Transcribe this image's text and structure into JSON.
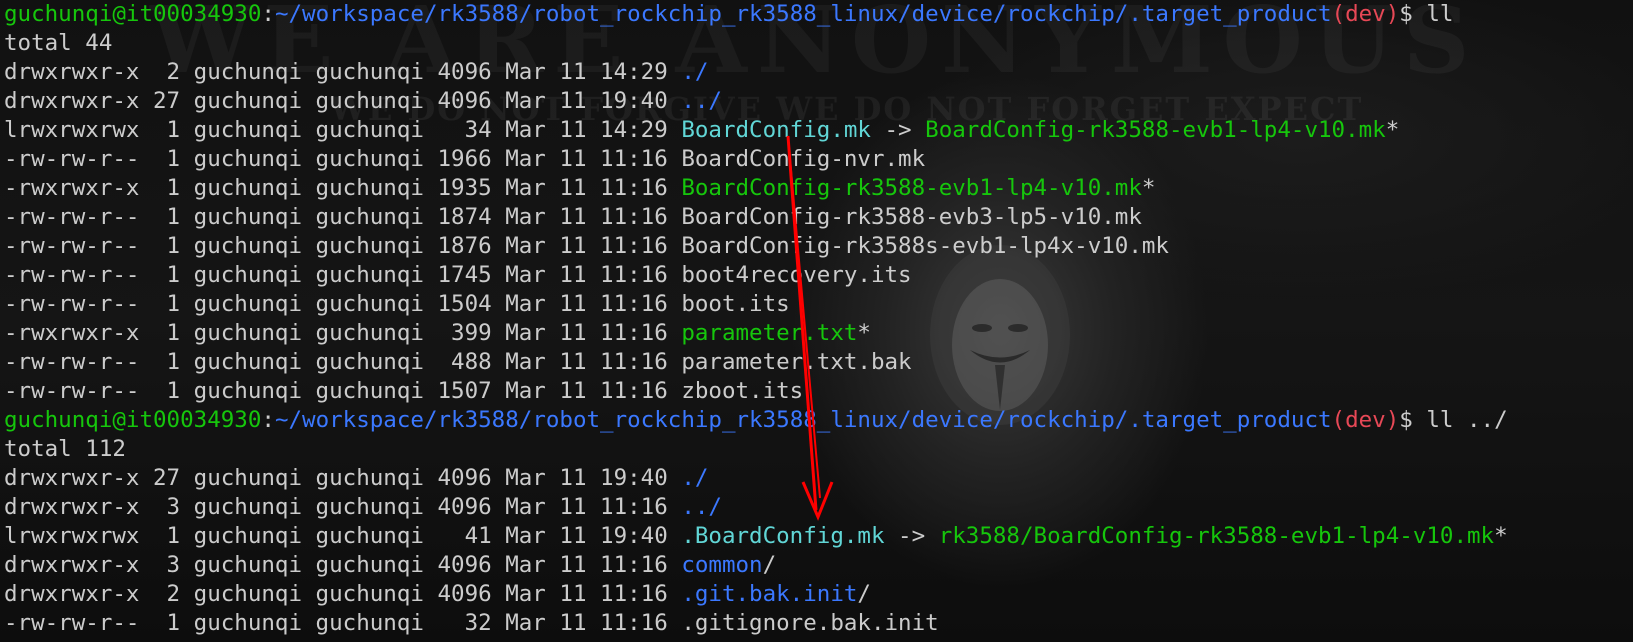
{
  "wallpaper": {
    "big_text": "WE ARE ANONYMOUS",
    "sub_text": "WE DO NOT FORGIVE WE DO NOT FORGET EXPECT"
  },
  "prompt1": {
    "user": "guchunqi@it00034930",
    "sep": ":",
    "path": "~/workspace/rk3588/robot_rockchip_rk3588_linux/device/rockchip/.target_product",
    "branch": "(dev)",
    "dollar": "$ ",
    "command": "ll"
  },
  "total1": "total 44",
  "listing1": [
    {
      "meta": "drwxrwxr-x  2 guchunqi guchunqi 4096 Mar 11 14:29 ",
      "name": "./",
      "color": "blue"
    },
    {
      "meta": "drwxrwxr-x 27 guchunqi guchunqi 4096 Mar 11 19:40 ",
      "name": "../",
      "color": "blue"
    },
    {
      "meta": "lrwxrwxrwx  1 guchunqi guchunqi   34 Mar 11 14:29 ",
      "name": "BoardConfig.mk",
      "color": "cyan",
      "arrow": " -> ",
      "target": "BoardConfig-rk3588-evb1-lp4-v10.mk",
      "target_color": "green",
      "suffix": "*"
    },
    {
      "meta": "-rw-rw-r--  1 guchunqi guchunqi 1966 Mar 11 11:16 ",
      "name": "BoardConfig-nvr.mk",
      "color": "white"
    },
    {
      "meta": "-rwxrwxr-x  1 guchunqi guchunqi 1935 Mar 11 11:16 ",
      "name": "BoardConfig-rk3588-evb1-lp4-v10.mk",
      "color": "green",
      "suffix": "*"
    },
    {
      "meta": "-rw-rw-r--  1 guchunqi guchunqi 1874 Mar 11 11:16 ",
      "name": "BoardConfig-rk3588-evb3-lp5-v10.mk",
      "color": "white"
    },
    {
      "meta": "-rw-rw-r--  1 guchunqi guchunqi 1876 Mar 11 11:16 ",
      "name": "BoardConfig-rk3588s-evb1-lp4x-v10.mk",
      "color": "white"
    },
    {
      "meta": "-rw-rw-r--  1 guchunqi guchunqi 1745 Mar 11 11:16 ",
      "name": "boot4recovery.its",
      "color": "white"
    },
    {
      "meta": "-rw-rw-r--  1 guchunqi guchunqi 1504 Mar 11 11:16 ",
      "name": "boot.its",
      "color": "white"
    },
    {
      "meta": "-rwxrwxr-x  1 guchunqi guchunqi  399 Mar 11 11:16 ",
      "name": "parameter.txt",
      "color": "green",
      "suffix": "*"
    },
    {
      "meta": "-rw-rw-r--  1 guchunqi guchunqi  488 Mar 11 11:16 ",
      "name": "parameter.txt.bak",
      "color": "white"
    },
    {
      "meta": "-rw-rw-r--  1 guchunqi guchunqi 1507 Mar 11 11:16 ",
      "name": "zboot.its",
      "color": "white"
    }
  ],
  "prompt2": {
    "user": "guchunqi@it00034930",
    "sep": ":",
    "path": "~/workspace/rk3588/robot_rockchip_rk3588_linux/device/rockchip/.target_product",
    "branch": "(dev)",
    "dollar": "$ ",
    "command": "ll ../"
  },
  "total2": "total 112",
  "listing2": [
    {
      "meta": "drwxrwxr-x 27 guchunqi guchunqi 4096 Mar 11 19:40 ",
      "name": "./",
      "color": "blue"
    },
    {
      "meta": "drwxrwxr-x  3 guchunqi guchunqi 4096 Mar 11 11:16 ",
      "name": "../",
      "color": "blue"
    },
    {
      "meta": "lrwxrwxrwx  1 guchunqi guchunqi   41 Mar 11 19:40 ",
      "name": ".BoardConfig.mk",
      "color": "cyan",
      "arrow": " -> ",
      "target": "rk3588/BoardConfig-rk3588-evb1-lp4-v10.mk",
      "target_color": "green",
      "suffix": "*"
    },
    {
      "meta": "drwxrwxr-x  3 guchunqi guchunqi 4096 Mar 11 11:16 ",
      "name": "common",
      "color": "blue",
      "suffix": "/"
    },
    {
      "meta": "drwxrwxr-x  2 guchunqi guchunqi 4096 Mar 11 11:16 ",
      "name": ".git.bak.init",
      "color": "blue",
      "suffix": "/"
    },
    {
      "meta": "-rw-rw-r--  1 guchunqi guchunqi   32 Mar 11 11:16 ",
      "name": ".gitignore.bak.init",
      "color": "white"
    }
  ],
  "colors": {
    "green": "#16c60c",
    "blue": "#3b78ff",
    "red": "#e74856",
    "cyan": "#61d6d6",
    "white": "#cccccc",
    "annotation_arrow": "#ff0000"
  }
}
